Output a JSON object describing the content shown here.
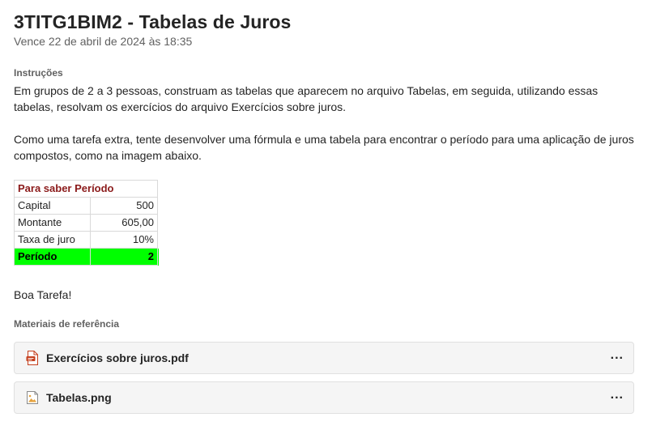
{
  "assignment": {
    "title": "3TITG1BIM2 - Tabelas de Juros",
    "due": "Vence 22 de abril de 2024 às 18:35"
  },
  "instructions": {
    "label": "Instruções",
    "paragraph1": "Em grupos de 2 a 3 pessoas, construam as tabelas que aparecem no arquivo Tabelas, em seguida, utilizando essas tabelas, resolvam os exercícios do arquivo Exercícios sobre juros.",
    "paragraph2": "Como uma tarefa extra, tente desenvolver uma fórmula e uma tabela para encontrar o período para uma aplicação de juros compostos, como na imagem abaixo.",
    "closing": "Boa Tarefa!"
  },
  "sheet": {
    "header": "Para saber Período",
    "rows": [
      {
        "label": "Capital",
        "value": "500"
      },
      {
        "label": "Montante",
        "value": "605,00"
      },
      {
        "label": "Taxa de juro",
        "value": "10%"
      }
    ],
    "result": {
      "label": "Período",
      "value": "2"
    },
    "colors": {
      "header_text": "#8b1a1a",
      "result_fill": "#00ff00"
    }
  },
  "references": {
    "label": "Materiais de referência",
    "files": [
      {
        "name": "Exercícios sobre juros.pdf",
        "icon": "pdf-file-icon",
        "more": "..."
      },
      {
        "name": "Tabelas.png",
        "icon": "image-file-icon",
        "more": "..."
      }
    ]
  }
}
